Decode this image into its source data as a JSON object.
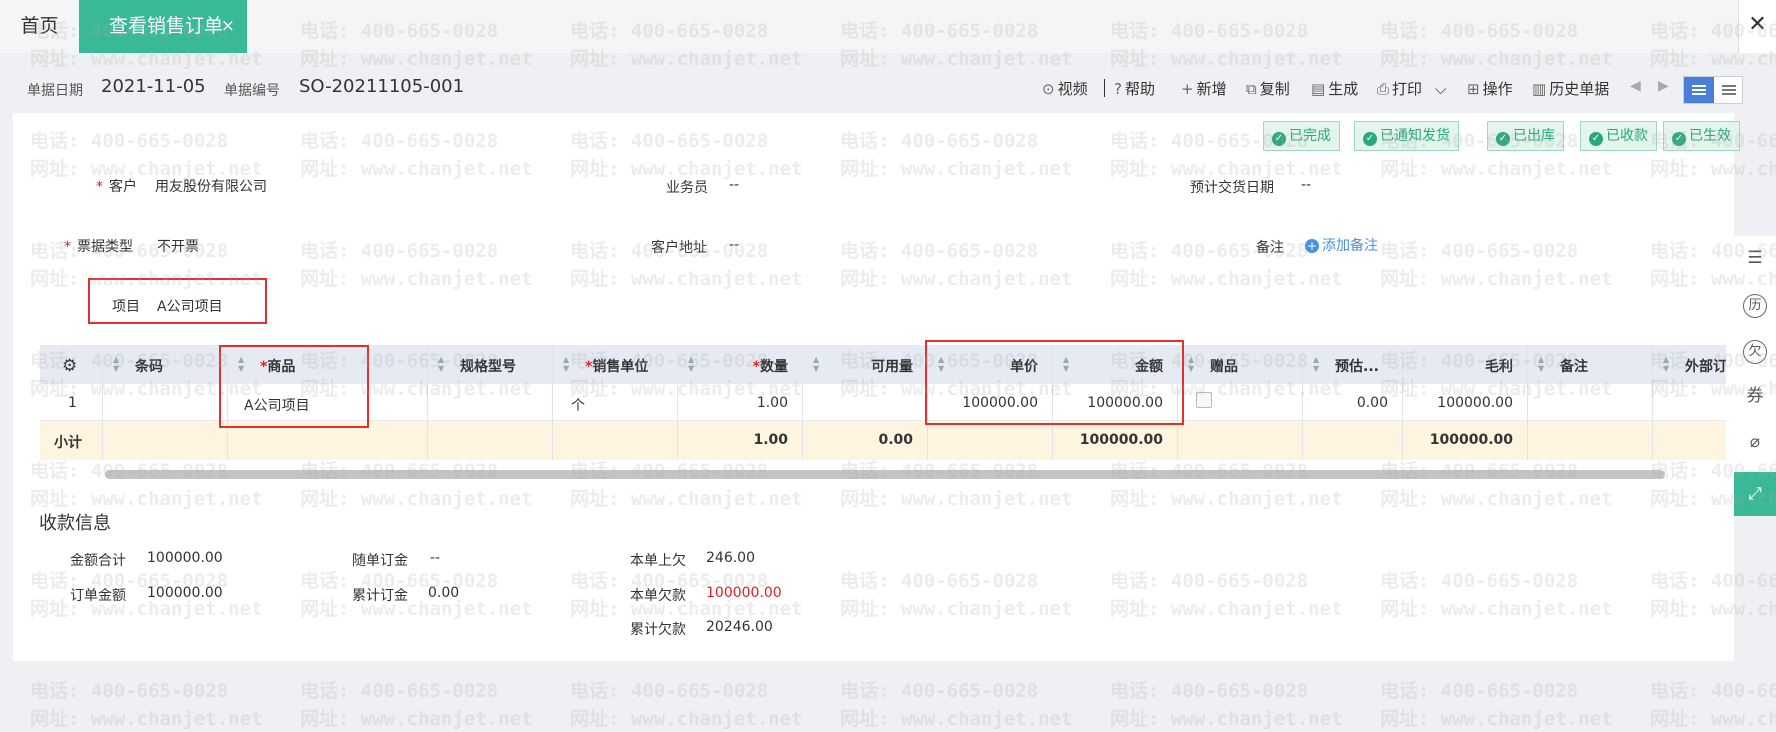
{
  "tabs": {
    "home": "首页",
    "active": "查看销售订单",
    "active_close": "×",
    "window_close": "✕"
  },
  "header": {
    "date_label": "单据日期",
    "date_value": "2021-11-05",
    "number_label": "单据编号",
    "number_value": "SO-20211105-001"
  },
  "toolbar": {
    "video": "视频",
    "help": "帮助",
    "new": "新增",
    "copy": "复制",
    "generate": "生成",
    "print": "打印",
    "operate": "操作",
    "history": "历史单据"
  },
  "statuses": [
    "已完成",
    "已通知发货",
    "已出库",
    "已收款",
    "已生效"
  ],
  "form": {
    "customer_label": "客户",
    "customer_value": "用友股份有限公司",
    "salesman_label": "业务员",
    "salesman_value": "--",
    "delivery_label": "预计交货日期",
    "delivery_value": "--",
    "invoice_label": "票据类型",
    "invoice_value": "不开票",
    "address_label": "客户地址",
    "address_value": "--",
    "note_label": "备注",
    "add_note": "添加备注",
    "project_label": "项目",
    "project_value": "A公司项目"
  },
  "table": {
    "headers": {
      "barcode": "条码",
      "product": "商品",
      "spec": "规格型号",
      "unit": "销售单位",
      "qty": "数量",
      "available": "可用量",
      "price": "单价",
      "amount": "金额",
      "gift": "赠品",
      "estimate": "预估...",
      "gross": "毛利",
      "remark": "备注",
      "external": "外部订"
    },
    "row": {
      "index": "1",
      "product": "A公司项目",
      "unit": "个",
      "qty": "1.00",
      "price": "100000.00",
      "amount": "100000.00",
      "estimate": "0.00",
      "gross": "100000.00"
    },
    "total": {
      "label": "小计",
      "qty": "1.00",
      "available": "0.00",
      "amount": "100000.00",
      "gross": "100000.00"
    }
  },
  "payment": {
    "title": "收款信息",
    "total_label": "金额合计",
    "total_value": "100000.00",
    "deposit_label": "随单订金",
    "deposit_value": "--",
    "prev_debt_label": "本单上欠",
    "prev_debt_value": "246.00",
    "order_label": "订单金额",
    "order_value": "100000.00",
    "cum_deposit_label": "累计订金",
    "cum_deposit_value": "0.00",
    "this_debt_label": "本单欠款",
    "this_debt_value": "100000.00",
    "cum_debt_label": "累计欠款",
    "cum_debt_value": "20246.00"
  },
  "rail": {
    "history": "历",
    "debt": "欠",
    "coupon": "券"
  },
  "watermark": {
    "phone": "电话: 400-665-0028",
    "site": "网址: www.chanjet.net"
  },
  "colors": {
    "accent": "#3ab999",
    "status_green": "#2aa87d",
    "required": "#e02020",
    "link": "#4a90e2",
    "highlight_box": "#e03030"
  }
}
